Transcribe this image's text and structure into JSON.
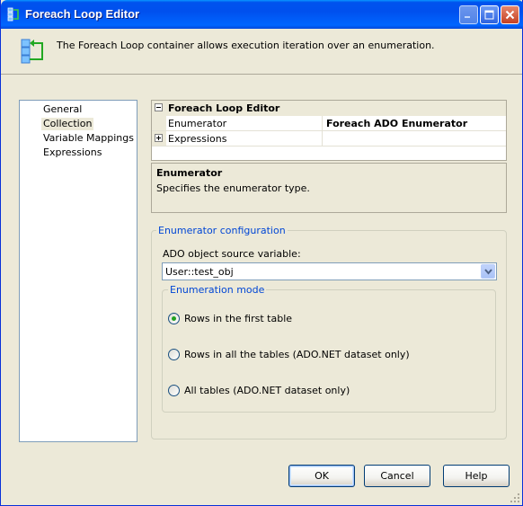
{
  "window": {
    "title": "Foreach Loop Editor"
  },
  "header": {
    "description": "The Foreach Loop container allows execution iteration over an enumeration."
  },
  "nav": {
    "items": [
      {
        "label": "General"
      },
      {
        "label": "Collection"
      },
      {
        "label": "Variable Mappings"
      },
      {
        "label": "Expressions"
      }
    ],
    "selected": "Collection"
  },
  "property_grid": {
    "category": "Foreach Loop Editor",
    "rows": [
      {
        "name": "Enumerator",
        "value": "Foreach ADO Enumerator"
      },
      {
        "name": "Expressions",
        "value": ""
      }
    ]
  },
  "description_panel": {
    "title": "Enumerator",
    "text": "Specifies the enumerator type."
  },
  "enumerator_config": {
    "legend": "Enumerator configuration",
    "source_label": "ADO object source variable:",
    "source_value": "User::test_obj",
    "mode_legend": "Enumeration mode",
    "options": [
      {
        "label": "Rows in the first table",
        "checked": true
      },
      {
        "label": "Rows in all the tables (ADO.NET dataset only)",
        "checked": false
      },
      {
        "label": "All tables (ADO.NET dataset only)",
        "checked": false
      }
    ]
  },
  "buttons": {
    "ok": "OK",
    "cancel": "Cancel",
    "help": "Help"
  },
  "colors": {
    "title_bar": "#0053ee",
    "dialog_bg": "#ece9d8",
    "legend_text": "#0046d5",
    "radio_dot": "#21a121"
  }
}
